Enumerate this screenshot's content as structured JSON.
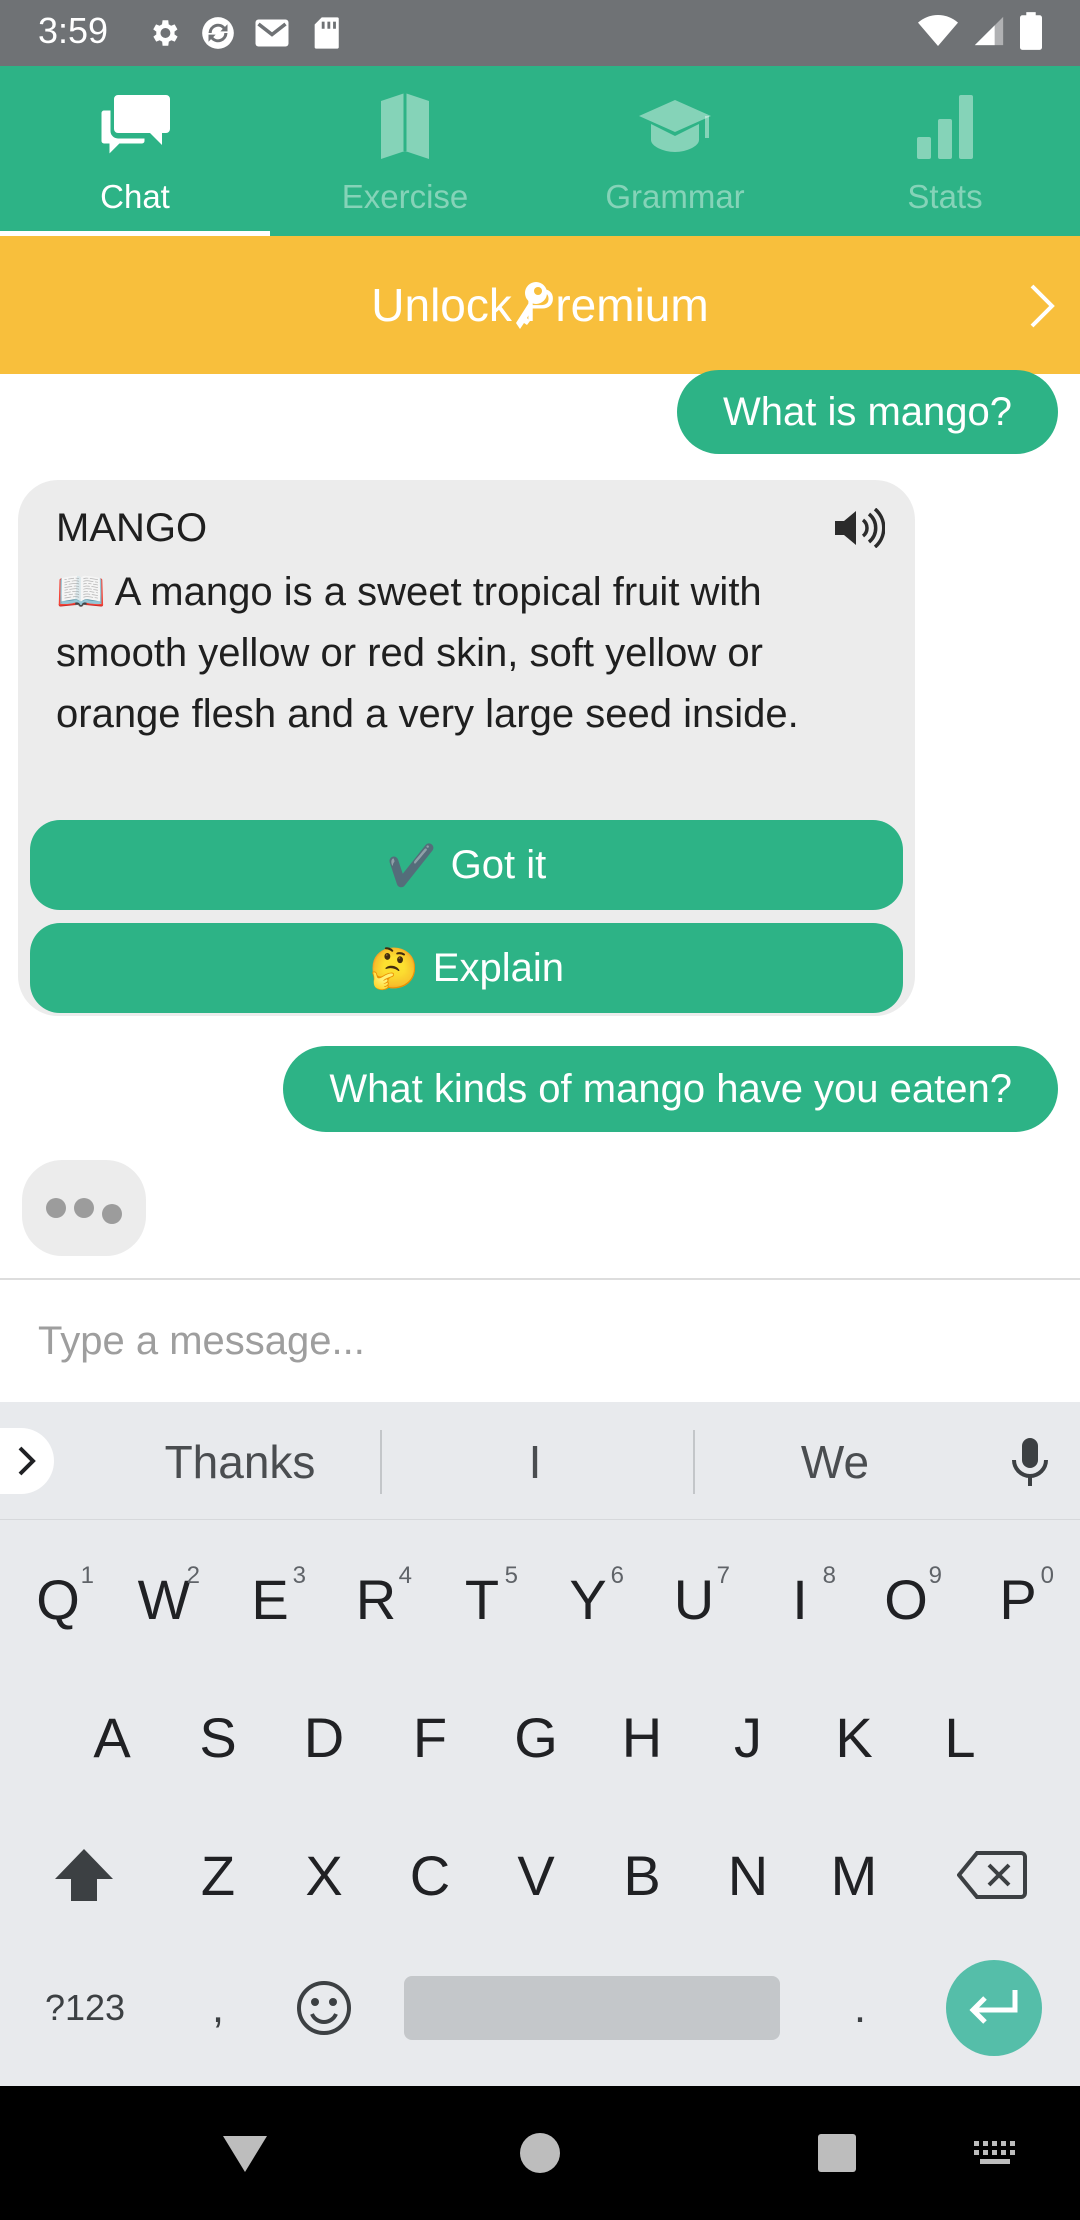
{
  "status_bar": {
    "time": "3:59",
    "icons_left": [
      "settings-icon",
      "sync-icon",
      "gmail-icon",
      "sd-card-icon"
    ],
    "icons_right": [
      "wifi-icon",
      "signal-icon",
      "battery-icon"
    ]
  },
  "tabs": [
    {
      "label": "Chat",
      "icon": "chat-icon",
      "active": true
    },
    {
      "label": "Exercise",
      "icon": "book-icon",
      "active": false
    },
    {
      "label": "Grammar",
      "icon": "graduation-cap-icon",
      "active": false
    },
    {
      "label": "Stats",
      "icon": "bar-chart-icon",
      "active": false
    }
  ],
  "premium": {
    "label": "Unlock Premium",
    "icon": "key-icon"
  },
  "chat": {
    "user_message_1": "What is mango?",
    "bot_card": {
      "word": "MANGO",
      "definition_emoji": "📖",
      "definition": "A mango is a sweet tropical fruit with smooth yellow or red skin, soft yellow or orange flesh and a very large seed inside.",
      "buttons": [
        {
          "emoji": "✔️",
          "label": "Got it"
        },
        {
          "emoji": "🤔",
          "label": "Explain"
        }
      ]
    },
    "user_message_2": "What kinds of mango have you eaten?"
  },
  "input": {
    "placeholder": "Type a message...",
    "value": ""
  },
  "keyboard": {
    "suggestions": [
      "Thanks",
      "I",
      "We"
    ],
    "row1": [
      {
        "key": "Q",
        "num": "1"
      },
      {
        "key": "W",
        "num": "2"
      },
      {
        "key": "E",
        "num": "3"
      },
      {
        "key": "R",
        "num": "4"
      },
      {
        "key": "T",
        "num": "5"
      },
      {
        "key": "Y",
        "num": "6"
      },
      {
        "key": "U",
        "num": "7"
      },
      {
        "key": "I",
        "num": "8"
      },
      {
        "key": "O",
        "num": "9"
      },
      {
        "key": "P",
        "num": "0"
      }
    ],
    "row2": [
      "A",
      "S",
      "D",
      "F",
      "G",
      "H",
      "J",
      "K",
      "L"
    ],
    "row3": [
      "Z",
      "X",
      "C",
      "V",
      "B",
      "N",
      "M"
    ],
    "symbols_key": "?123",
    "comma_key": ",",
    "period_key": "."
  }
}
